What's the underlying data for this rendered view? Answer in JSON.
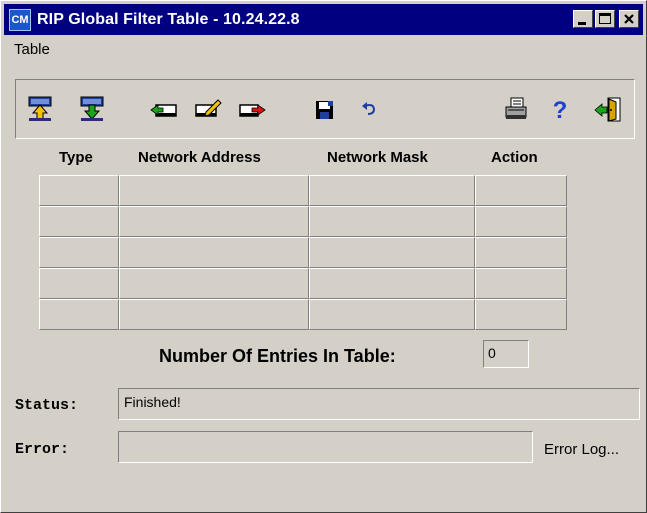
{
  "window": {
    "title": "RIP Global Filter Table - 10.24.22.8",
    "app_icon_text": "CM"
  },
  "menu": {
    "items": [
      "Table"
    ]
  },
  "toolbar": {
    "icons": [
      "upload-icon",
      "download-icon",
      "add-entry-icon",
      "edit-entry-icon",
      "delete-entry-icon",
      "save-icon",
      "undo-icon",
      "print-icon",
      "help-icon",
      "exit-icon"
    ]
  },
  "table": {
    "columns": [
      "Type",
      "Network Address",
      "Network Mask",
      "Action"
    ],
    "rows": [
      [
        "",
        "",
        "",
        ""
      ],
      [
        "",
        "",
        "",
        ""
      ],
      [
        "",
        "",
        "",
        ""
      ],
      [
        "",
        "",
        "",
        ""
      ],
      [
        "",
        "",
        "",
        ""
      ]
    ]
  },
  "entries": {
    "label": "Number Of Entries In Table:",
    "value": "0"
  },
  "status": {
    "label": "Status:",
    "value": "Finished!"
  },
  "error": {
    "label": "Error:",
    "value": "",
    "log_link": "Error Log..."
  },
  "colors": {
    "titlebar": "#000080",
    "face": "#d4d0c8"
  }
}
